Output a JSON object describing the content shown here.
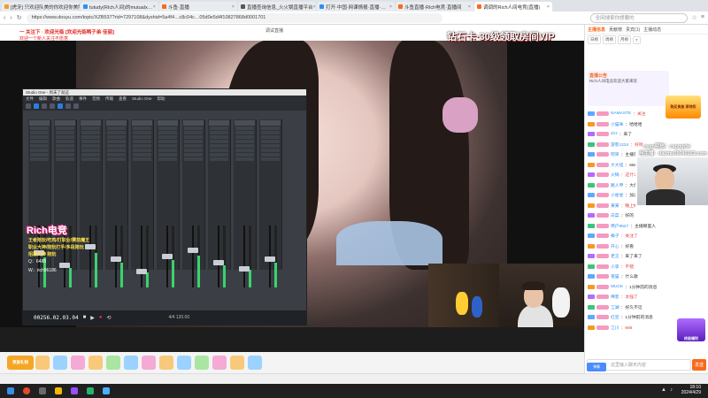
{
  "browser": {
    "tabs": [
      {
        "label": "[虎牙] 只欢迎队美的你欢迎你美队",
        "color": "#f59a23"
      },
      {
        "label": "tutudy(RIch人间)的mutualx…",
        "color": "#2c8ff3"
      },
      {
        "label": "斗鱼·直播",
        "color": "#f76b1c"
      },
      {
        "label": "直播查询信息_火火锅直播平台",
        "color": "#555555"
      },
      {
        "label": "打开·中国·网课情报·直播·…",
        "color": "#2c8ff3"
      },
      {
        "label": "斗鱼直播·RIch电竞·直播间",
        "color": "#f76b1c"
      },
      {
        "label": "调调的Rich人间电竞(直播)",
        "color": "#f76b1c"
      }
    ],
    "url": "https://www.douyu.com/topic/XZB537?rid=7297108&dyshid=5a4f4…c8c04c…05d0e5d4f10827868d0001701",
    "search_placeholder": "全网搜索你想要的"
  },
  "stream": {
    "banner_left_1": "一 关注下 · 欢迎光临 [欢迎光临鸭子弟·佳丽]",
    "banner_left_2": "欢迎一个新人关注不愿意",
    "title_center": "调试直播",
    "banner_right": "钻石卡·30级领取房间VIP",
    "studio_title": "Studio One - 周末了就这",
    "studio_menu": [
      "文件",
      "编辑",
      "歌曲",
      "轨道",
      "事件",
      "音频",
      "传输",
      "查看",
      "Studio One",
      "帮助"
    ],
    "timecode": "00256.02.03.04",
    "tempo": "4/4    120.00",
    "rich_title": "Rich电竞",
    "rich_lines": [
      "王者陪玩/吃鸡/打职业/赛前魔王",
      "职业大神/陪玩打手/多段陪玩",
      "招募大神 陪玩"
    ],
    "rich_qq": "Q：6488",
    "rich_wx": "W：rich96186",
    "gift_badge": "贵族礼物"
  },
  "panel": {
    "tabs": [
      "主播信息",
      "贡献榜",
      "贵宾(1)",
      "主播动态"
    ],
    "rank_buttons": [
      "日榜",
      "周榜",
      "月榜",
      "7"
    ],
    "notice_title": "直播公告",
    "notice_text": "Rich人间电竞欢迎大家来玩",
    "broadcaster_id": "csgo明热：csgogdw",
    "broadcaster_id2": "当主播：daizhu09040163.com",
    "ad1": "购买贵族 享特权",
    "ad2": "终极福利",
    "chat": [
      {
        "user": "NAMASTE",
        "text": "：关注"
      },
      {
        "user": "小猫咪",
        "text": "：哈哈哈"
      },
      {
        "user": "Zzz",
        "text": "：来了"
      },
      {
        "user": "游客1234",
        "text": "：好听"
      },
      {
        "user": "阿呆",
        "text": "：主播在干嘛"
      },
      {
        "user": "大大怪",
        "text": "：666"
      },
      {
        "user": "火锅",
        "text": "：这什么音乐"
      },
      {
        "user": "路人甲",
        "text": "：大佬"
      },
      {
        "user": "小星星",
        "text": "：加油"
      },
      {
        "user": "某某",
        "text": "：晚上好"
      },
      {
        "user": "白菜",
        "text": "：好的"
      },
      {
        "user": "用户9527",
        "text": "：主播哪里人"
      },
      {
        "user": "橘子",
        "text": "：关注了"
      },
      {
        "user": "开心",
        "text": "：好看"
      },
      {
        "user": "老王",
        "text": "：来了来了"
      },
      {
        "user": "小李",
        "text": "：不错"
      },
      {
        "user": "夜猫",
        "text": "：什么歌"
      },
      {
        "user": "MUCK",
        "text": "：1分钟前的消息"
      },
      {
        "user": "稀客",
        "text": "：太强了"
      },
      {
        "user": "江湖",
        "text": "：好久不见"
      },
      {
        "user": "红豆",
        "text": "：1分钟前的消息"
      },
      {
        "user": "江川",
        "text": "：666"
      }
    ],
    "danmu_label": "弹幕",
    "input_placeholder": "这里输入聊天内容",
    "send_label": "发送"
  },
  "taskbar": {
    "time": "18:10",
    "date": "2024/4/29"
  }
}
